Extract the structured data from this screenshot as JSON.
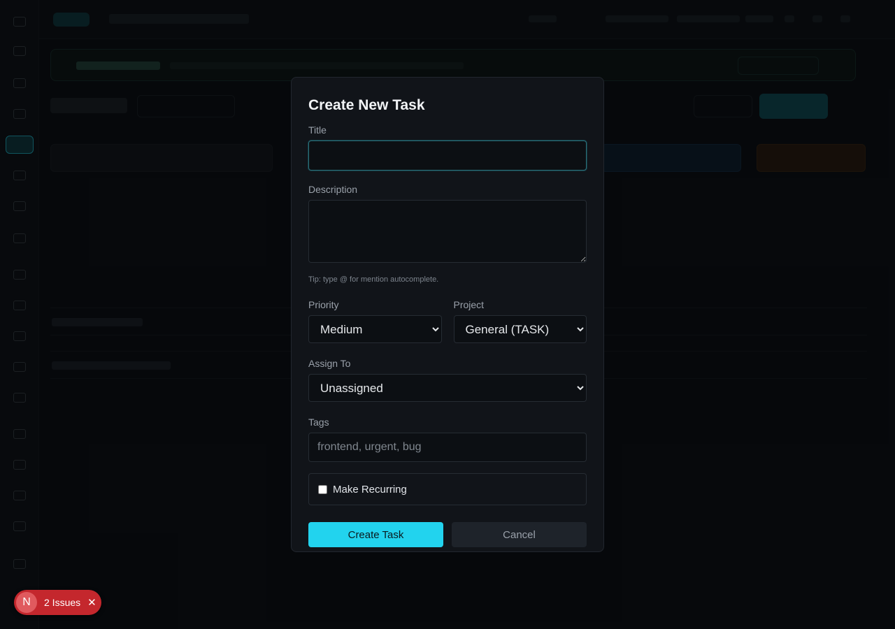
{
  "modal": {
    "title": "Create New Task",
    "title_label": "Title",
    "title_value": "",
    "description_label": "Description",
    "description_value": "",
    "tip": "Tip: type @ for mention autocomplete.",
    "priority_label": "Priority",
    "priority_selected": "Medium",
    "project_label": "Project",
    "project_selected": "General (TASK)",
    "assign_label": "Assign To",
    "assign_selected": "Unassigned",
    "tags_label": "Tags",
    "tags_placeholder": "frontend, urgent, bug",
    "recurring_label": "Make Recurring",
    "recurring_checked": false,
    "create_button": "Create Task",
    "cancel_button": "Cancel"
  },
  "issues_badge": {
    "logo_letter": "N",
    "label": "2 Issues",
    "close_icon": "close-icon"
  },
  "colors": {
    "accent": "#22d3ee",
    "issues_red": "#c4272d"
  }
}
